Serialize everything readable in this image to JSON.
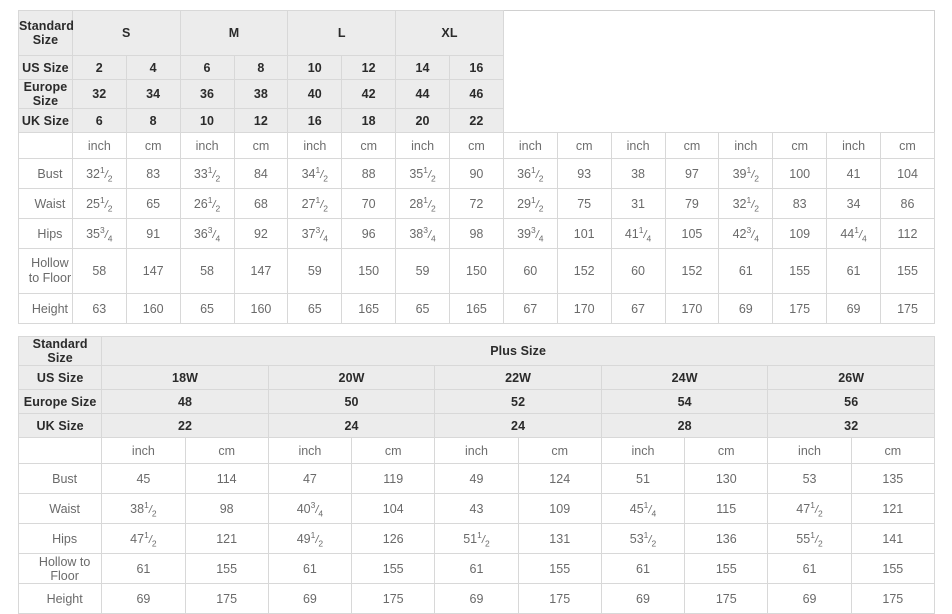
{
  "standard_table": {
    "corner_label": "Standard Size",
    "size_groups": [
      {
        "label": "S",
        "span": 2
      },
      {
        "label": "M",
        "span": 2
      },
      {
        "label": "L",
        "span": 2
      },
      {
        "label": "XL",
        "span": 2
      }
    ],
    "rows": [
      {
        "label": "US Size",
        "values": [
          "2",
          "4",
          "6",
          "8",
          "10",
          "12",
          "14",
          "16"
        ]
      },
      {
        "label": "Europe Size",
        "values": [
          "32",
          "34",
          "36",
          "38",
          "40",
          "42",
          "44",
          "46"
        ]
      },
      {
        "label": "UK Size",
        "values": [
          "6",
          "8",
          "10",
          "12",
          "16",
          "18",
          "20",
          "22"
        ]
      }
    ],
    "unit_row": {
      "label": "",
      "units": [
        "inch",
        "cm",
        "inch",
        "cm",
        "inch",
        "cm",
        "inch",
        "cm",
        "inch",
        "cm",
        "inch",
        "cm",
        "inch",
        "cm",
        "inch",
        "cm"
      ]
    },
    "measurements": [
      {
        "label": "Bust",
        "cells": [
          {
            "whole": "32",
            "num": "1",
            "den": "2"
          },
          {
            "whole": "83"
          },
          {
            "whole": "33",
            "num": "1",
            "den": "2"
          },
          {
            "whole": "84"
          },
          {
            "whole": "34",
            "num": "1",
            "den": "2"
          },
          {
            "whole": "88"
          },
          {
            "whole": "35",
            "num": "1",
            "den": "2"
          },
          {
            "whole": "90"
          },
          {
            "whole": "36",
            "num": "1",
            "den": "2"
          },
          {
            "whole": "93"
          },
          {
            "whole": "38"
          },
          {
            "whole": "97"
          },
          {
            "whole": "39",
            "num": "1",
            "den": "2"
          },
          {
            "whole": "100"
          },
          {
            "whole": "41"
          },
          {
            "whole": "104"
          }
        ]
      },
      {
        "label": "Waist",
        "cells": [
          {
            "whole": "25",
            "num": "1",
            "den": "2"
          },
          {
            "whole": "65"
          },
          {
            "whole": "26",
            "num": "1",
            "den": "2"
          },
          {
            "whole": "68"
          },
          {
            "whole": "27",
            "num": "1",
            "den": "2"
          },
          {
            "whole": "70"
          },
          {
            "whole": "28",
            "num": "1",
            "den": "2"
          },
          {
            "whole": "72"
          },
          {
            "whole": "29",
            "num": "1",
            "den": "2"
          },
          {
            "whole": "75"
          },
          {
            "whole": "31"
          },
          {
            "whole": "79"
          },
          {
            "whole": "32",
            "num": "1",
            "den": "2"
          },
          {
            "whole": "83"
          },
          {
            "whole": "34"
          },
          {
            "whole": "86"
          }
        ]
      },
      {
        "label": "Hips",
        "cells": [
          {
            "whole": "35",
            "num": "3",
            "den": "4"
          },
          {
            "whole": "91"
          },
          {
            "whole": "36",
            "num": "3",
            "den": "4"
          },
          {
            "whole": "92"
          },
          {
            "whole": "37",
            "num": "3",
            "den": "4"
          },
          {
            "whole": "96"
          },
          {
            "whole": "38",
            "num": "3",
            "den": "4"
          },
          {
            "whole": "98"
          },
          {
            "whole": "39",
            "num": "3",
            "den": "4"
          },
          {
            "whole": "101"
          },
          {
            "whole": "41",
            "num": "1",
            "den": "4"
          },
          {
            "whole": "105"
          },
          {
            "whole": "42",
            "num": "3",
            "den": "4"
          },
          {
            "whole": "109"
          },
          {
            "whole": "44",
            "num": "1",
            "den": "4"
          },
          {
            "whole": "112"
          }
        ]
      },
      {
        "label": "Hollow to Floor",
        "two_line": true,
        "cells": [
          {
            "whole": "58"
          },
          {
            "whole": "147"
          },
          {
            "whole": "58"
          },
          {
            "whole": "147"
          },
          {
            "whole": "59"
          },
          {
            "whole": "150"
          },
          {
            "whole": "59"
          },
          {
            "whole": "150"
          },
          {
            "whole": "60"
          },
          {
            "whole": "152"
          },
          {
            "whole": "60"
          },
          {
            "whole": "152"
          },
          {
            "whole": "61"
          },
          {
            "whole": "155"
          },
          {
            "whole": "61"
          },
          {
            "whole": "155"
          }
        ]
      },
      {
        "label": "Height",
        "cells": [
          {
            "whole": "63"
          },
          {
            "whole": "160"
          },
          {
            "whole": "65"
          },
          {
            "whole": "160"
          },
          {
            "whole": "65"
          },
          {
            "whole": "165"
          },
          {
            "whole": "65"
          },
          {
            "whole": "165"
          },
          {
            "whole": "67"
          },
          {
            "whole": "170"
          },
          {
            "whole": "67"
          },
          {
            "whole": "170"
          },
          {
            "whole": "69"
          },
          {
            "whole": "175"
          },
          {
            "whole": "69"
          },
          {
            "whole": "175"
          }
        ]
      }
    ]
  },
  "plus_table": {
    "corner_label": "Standard Size",
    "group_label": "Plus Size",
    "rows": [
      {
        "label": "US Size",
        "values": [
          "18W",
          "20W",
          "22W",
          "24W",
          "26W"
        ]
      },
      {
        "label": "Europe Size",
        "values": [
          "48",
          "50",
          "52",
          "54",
          "56"
        ]
      },
      {
        "label": "UK Size",
        "values": [
          "22",
          "24",
          "24",
          "28",
          "32"
        ]
      }
    ],
    "unit_row": {
      "label": "",
      "units": [
        "inch",
        "cm",
        "inch",
        "cm",
        "inch",
        "cm",
        "inch",
        "cm",
        "inch",
        "cm"
      ]
    },
    "measurements": [
      {
        "label": "Bust",
        "cells": [
          {
            "whole": "45"
          },
          {
            "whole": "114"
          },
          {
            "whole": "47"
          },
          {
            "whole": "119"
          },
          {
            "whole": "49"
          },
          {
            "whole": "124"
          },
          {
            "whole": "51"
          },
          {
            "whole": "130"
          },
          {
            "whole": "53"
          },
          {
            "whole": "135"
          }
        ]
      },
      {
        "label": "Waist",
        "cells": [
          {
            "whole": "38",
            "num": "1",
            "den": "2"
          },
          {
            "whole": "98"
          },
          {
            "whole": "40",
            "num": "3",
            "den": "4"
          },
          {
            "whole": "104"
          },
          {
            "whole": "43"
          },
          {
            "whole": "109"
          },
          {
            "whole": "45",
            "num": "1",
            "den": "4"
          },
          {
            "whole": "115"
          },
          {
            "whole": "47",
            "num": "1",
            "den": "2"
          },
          {
            "whole": "121"
          }
        ]
      },
      {
        "label": "Hips",
        "cells": [
          {
            "whole": "47",
            "num": "1",
            "den": "2"
          },
          {
            "whole": "121"
          },
          {
            "whole": "49",
            "num": "1",
            "den": "2"
          },
          {
            "whole": "126"
          },
          {
            "whole": "51",
            "num": "1",
            "den": "2"
          },
          {
            "whole": "131"
          },
          {
            "whole": "53",
            "num": "1",
            "den": "2"
          },
          {
            "whole": "136"
          },
          {
            "whole": "55",
            "num": "1",
            "den": "2"
          },
          {
            "whole": "141"
          }
        ]
      },
      {
        "label": "Hollow to Floor",
        "cells": [
          {
            "whole": "61"
          },
          {
            "whole": "155"
          },
          {
            "whole": "61"
          },
          {
            "whole": "155"
          },
          {
            "whole": "61"
          },
          {
            "whole": "155"
          },
          {
            "whole": "61"
          },
          {
            "whole": "155"
          },
          {
            "whole": "61"
          },
          {
            "whole": "155"
          }
        ]
      },
      {
        "label": "Height",
        "cells": [
          {
            "whole": "69"
          },
          {
            "whole": "175"
          },
          {
            "whole": "69"
          },
          {
            "whole": "175"
          },
          {
            "whole": "69"
          },
          {
            "whole": "175"
          },
          {
            "whole": "69"
          },
          {
            "whole": "175"
          },
          {
            "whole": "69"
          },
          {
            "whole": "175"
          }
        ]
      }
    ]
  },
  "colors": {
    "header_bg": "#ececec",
    "header_text": "#2b2b2b",
    "body_text": "#6a6a6a",
    "border": "#d8d8d8",
    "page_bg": "#ffffff"
  }
}
